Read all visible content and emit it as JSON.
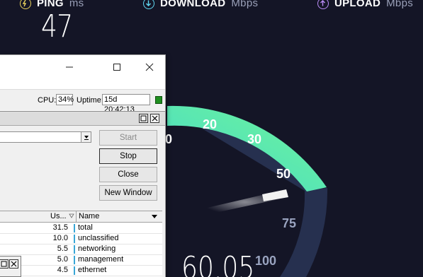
{
  "speedtest": {
    "ping_label": "PING",
    "ping_unit": "ms",
    "ping_value": "47",
    "download_label": "DOWNLOAD",
    "download_unit": "Mbps",
    "upload_label": "UPLOAD",
    "upload_unit": "Mbps",
    "current_speed": "60.05",
    "gauge_ticks": [
      "0",
      "20",
      "30",
      "50",
      "75",
      "100"
    ],
    "colors": {
      "ping": "#e8d25c",
      "download": "#5fd7f0",
      "upload": "#b98bf5",
      "gauge_start": "#4ee3c8",
      "gauge_end": "#6cf29a",
      "gauge_track": "#26304f"
    }
  },
  "window": {
    "buttons": {
      "maximize_icon": "maximize-icon",
      "close_icon": "close-icon"
    },
    "status": {
      "cpu_label": "CPU:",
      "cpu_value": "34%",
      "uptime_label": "Uptime:",
      "uptime_value": "15d 20:42:13"
    },
    "panel": {
      "buttons": [
        "Start",
        "Stop",
        "Close",
        "New Window"
      ],
      "columns": {
        "usage": "Us...",
        "name": "Name"
      },
      "rows": [
        {
          "usage": "31.5",
          "name": "total"
        },
        {
          "usage": "10.0",
          "name": "unclassified"
        },
        {
          "usage": "5.5",
          "name": "networking"
        },
        {
          "usage": "5.0",
          "name": "management"
        },
        {
          "usage": "4.5",
          "name": "ethernet"
        }
      ]
    }
  }
}
